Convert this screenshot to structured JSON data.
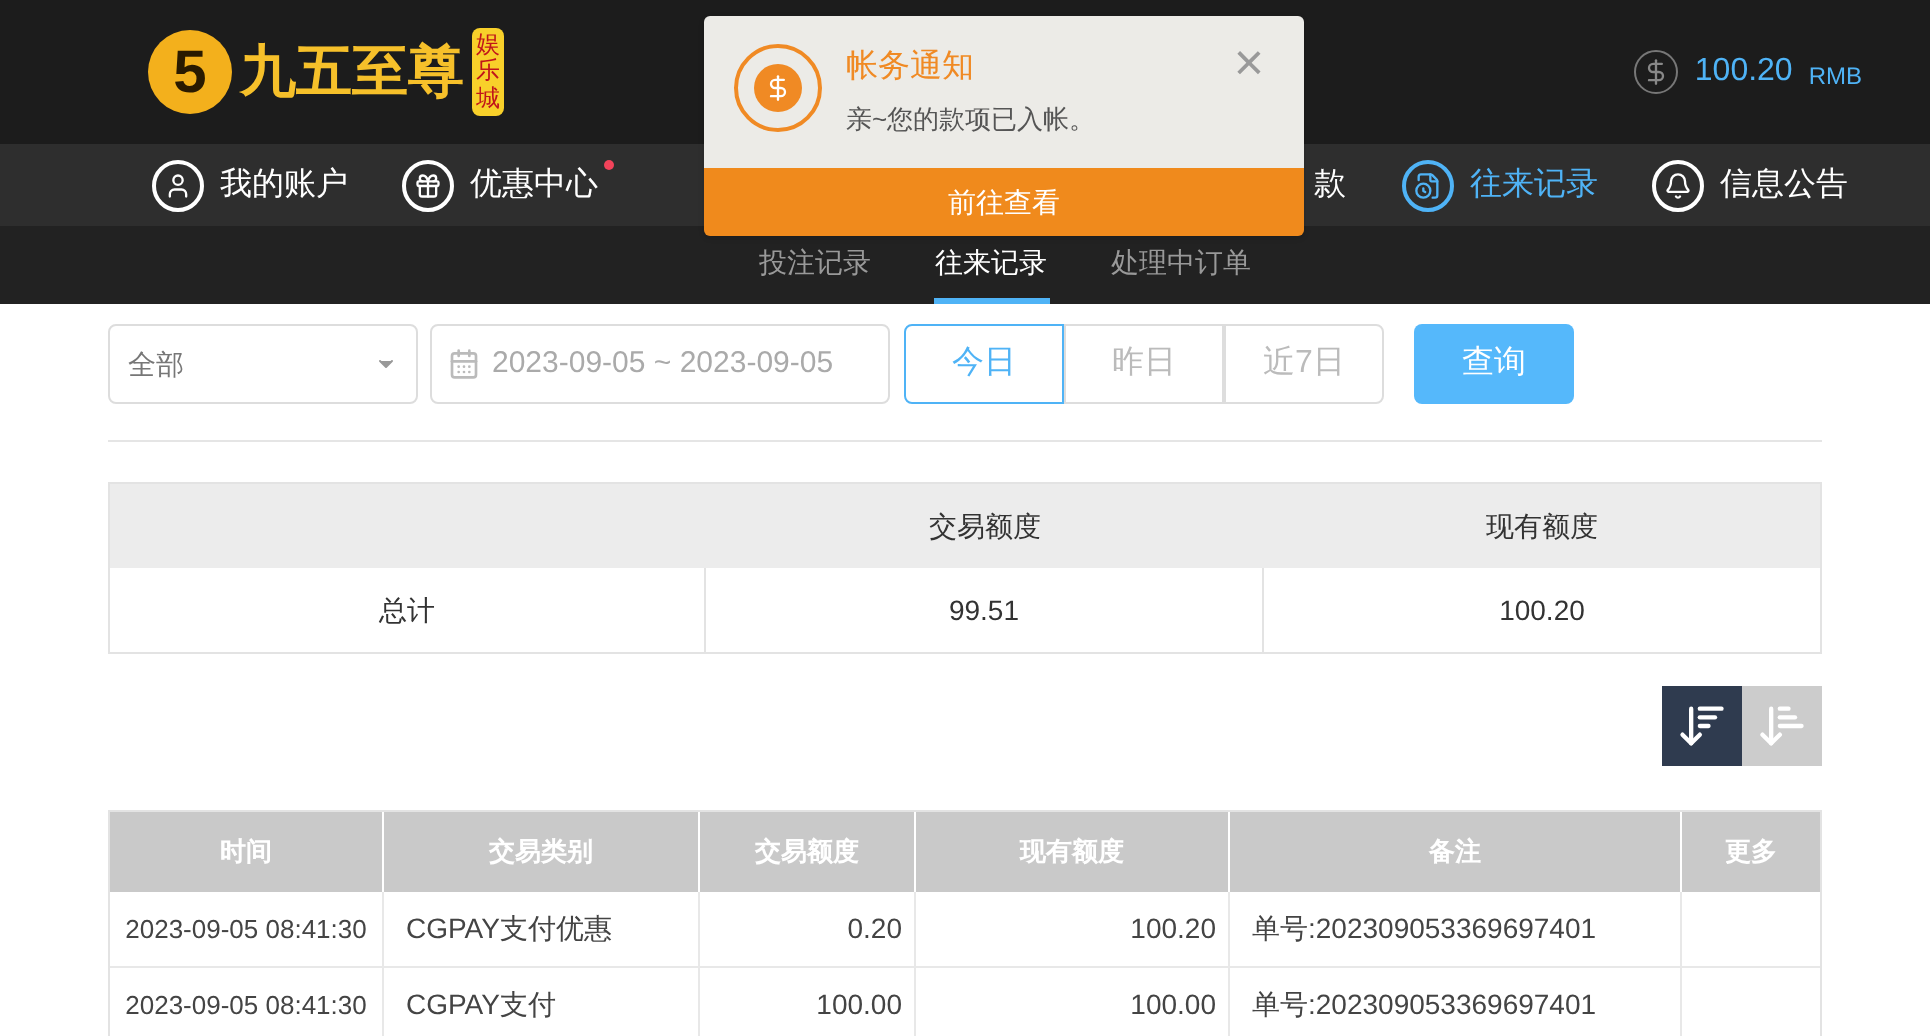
{
  "header": {
    "logo_numeral": "5",
    "logo_text": "九五至尊",
    "logo_badge": "娱乐城",
    "balance": "100.20",
    "currency": "RMB"
  },
  "nav": [
    {
      "kind": "full",
      "label": "我的账户",
      "selected": false,
      "dot": false
    },
    {
      "kind": "full",
      "label": "优惠中心",
      "selected": false,
      "dot": true
    },
    {
      "kind": "cut",
      "label": "款",
      "selected": false,
      "dot": false
    },
    {
      "kind": "full",
      "label": "往来记录",
      "selected": true,
      "dot": false
    },
    {
      "kind": "full",
      "label": "信息公告",
      "selected": false,
      "dot": false
    }
  ],
  "subtabs": [
    {
      "label": "投注记录",
      "selected": false
    },
    {
      "label": "往来记录",
      "selected": true
    },
    {
      "label": "处理中订单",
      "selected": false
    }
  ],
  "notification": {
    "title": "帐务通知",
    "message": "亲~您的款项已入帐。",
    "close": "×",
    "action": "前往查看"
  },
  "filters": {
    "type_select": "全部",
    "date_range": "2023-09-05 ~ 2023-09-05",
    "ranges": [
      {
        "label": "今日",
        "selected": true
      },
      {
        "label": "昨日",
        "selected": false
      },
      {
        "label": "近7日",
        "selected": false
      }
    ],
    "query": "查询"
  },
  "summary": {
    "columns": [
      "交易额度",
      "现有额度"
    ],
    "row": {
      "label": "总计",
      "values": [
        "99.51",
        "100.20"
      ]
    }
  },
  "sort_buttons": [
    {
      "selected": true
    },
    {
      "selected": false
    }
  ],
  "table": {
    "columns": [
      "时间",
      "交易类别",
      "交易额度",
      "现有额度",
      "备注",
      "更多"
    ],
    "rows": [
      [
        "2023-09-05 08:41:30",
        "CGPAY支付优惠",
        "0.20",
        "100.20",
        "单号:202309053369697401"
      ],
      [
        "2023-09-05 08:41:30",
        "CGPAY支付",
        "100.00",
        "100.00",
        "单号:202309053369697401"
      ]
    ]
  }
}
